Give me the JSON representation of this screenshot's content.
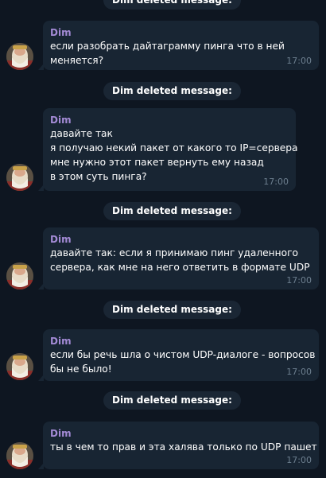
{
  "service_text": "Dim deleted message:",
  "messages": [
    {
      "author": "Dim",
      "lines": [
        "если разобрать дайтаграмму пинга что в ней",
        "меняется?"
      ],
      "time": "17:00"
    },
    {
      "author": "Dim",
      "lines": [
        "давайте так",
        "я получаю некий пакет от какого то IP=сервера",
        "мне нужно этот пакет вернуть ему назад",
        "в этом суть пинга?"
      ],
      "time": "17:00"
    },
    {
      "author": "Dim",
      "lines": [
        "давайте так: если я принимаю пинг удаленного",
        "сервера, как мне на него ответить в формате UDP"
      ],
      "time": "17:00"
    },
    {
      "author": "Dim",
      "lines": [
        "если бы речь шла о чистом UDP-диалоге - вопросов",
        "бы не было!"
      ],
      "time": "17:00"
    },
    {
      "author": "Dim",
      "lines": [
        "ты в чем то прав и эта халява только по UDP пашет"
      ],
      "time": "17:00"
    }
  ]
}
